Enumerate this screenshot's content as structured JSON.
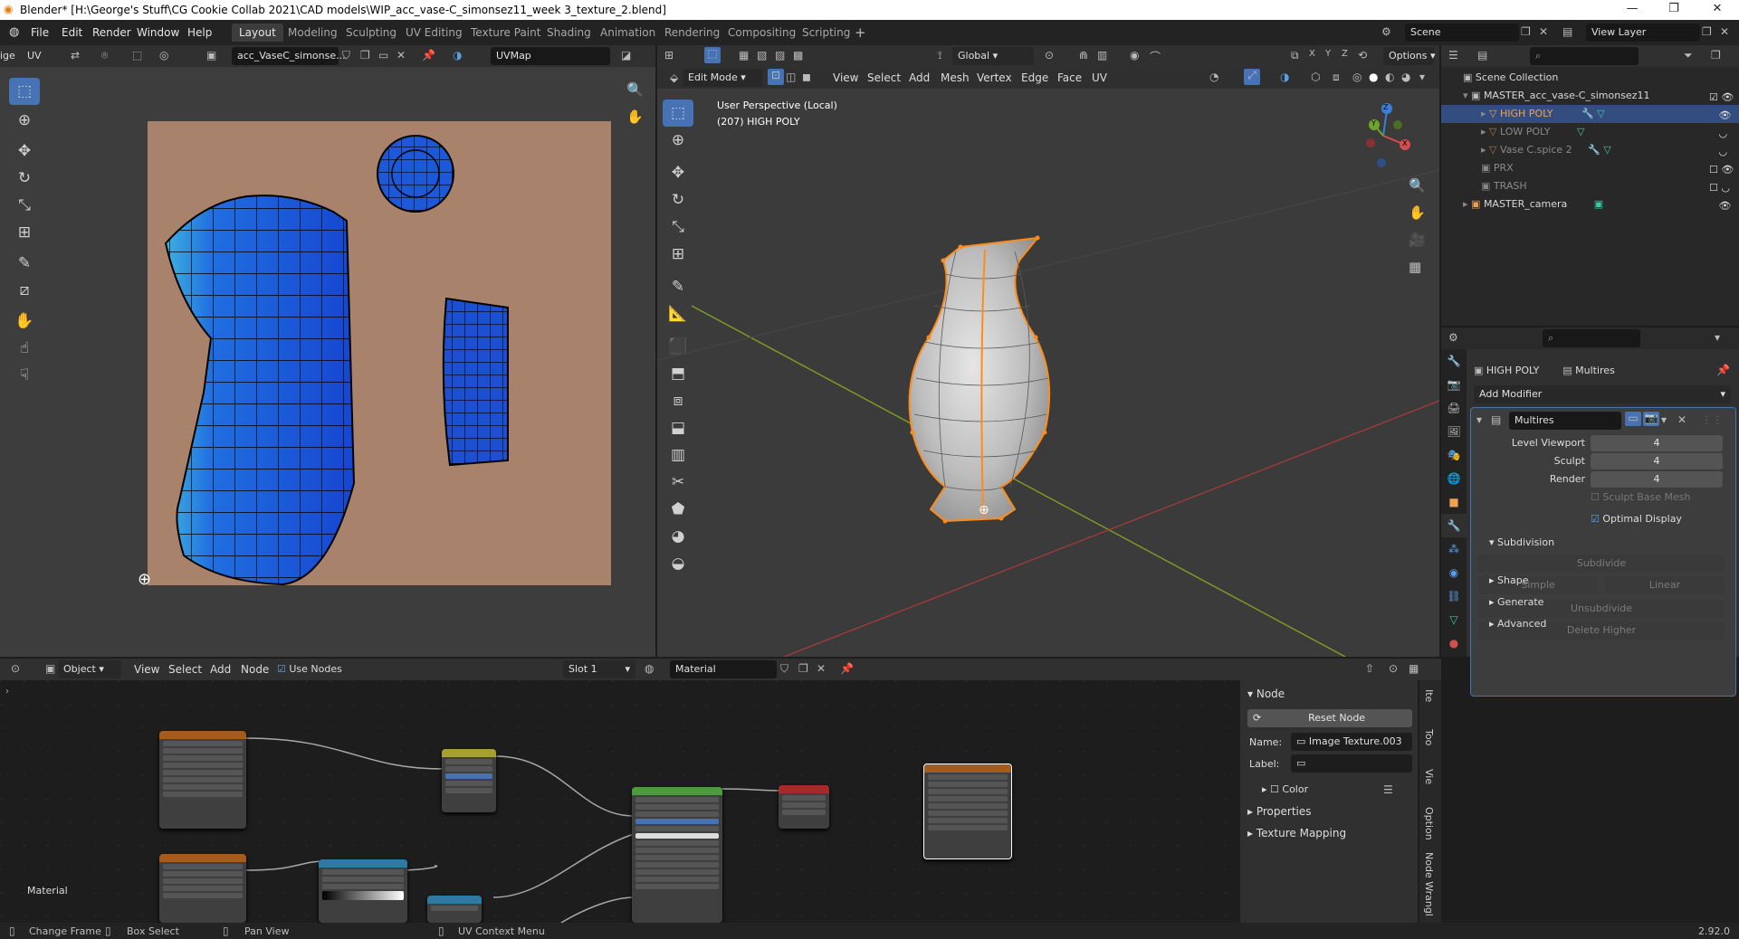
{
  "window": {
    "title": "Blender* [H:\\George's Stuff\\CG Cookie Collab 2021\\CAD models\\WIP_acc_vase-C_simonsez11_week 3_texture_2.blend]",
    "controls": [
      "—",
      "❐",
      "✕"
    ]
  },
  "menu": [
    "File",
    "Edit",
    "Render",
    "Window",
    "Help"
  ],
  "workspaces": [
    "Layout",
    "Modeling",
    "Sculpting",
    "UV Editing",
    "Texture Paint",
    "Shading",
    "Animation",
    "Rendering",
    "Compositing",
    "Scripting"
  ],
  "active_workspace": "Layout",
  "scene": {
    "label": "Scene",
    "view_layer": "View Layer"
  },
  "uv_editor": {
    "header_type": "ige",
    "menu": "UV",
    "image_name": "acc_VaseC_simonse...",
    "uvmap": "UVMap"
  },
  "viewport": {
    "mode": "Edit Mode",
    "menus": [
      "View",
      "Select",
      "Add",
      "Mesh",
      "Vertex",
      "Edge",
      "Face",
      "UV"
    ],
    "orientation": "Global",
    "options": "Options",
    "overlay_line1": "User Perspective (Local)",
    "overlay_line2": "(207) HIGH POLY",
    "gizmo_axes": [
      "Z",
      "Y",
      "X"
    ]
  },
  "outliner": {
    "root": "Scene Collection",
    "items": [
      {
        "label": "MASTER_acc_vase-C_simonsez11",
        "indent": 0,
        "color": "#d9d9d9"
      },
      {
        "label": "HIGH POLY",
        "indent": 1,
        "color": "#f0a050"
      },
      {
        "label": "LOW POLY",
        "indent": 1,
        "color": "#8a8a8a"
      },
      {
        "label": "Vase C.spice 2",
        "indent": 1,
        "color": "#8a8a8a"
      },
      {
        "label": "PRX",
        "indent": 0,
        "color": "#8a8a8a"
      },
      {
        "label": "TRASH",
        "indent": 0,
        "color": "#8a8a8a"
      },
      {
        "label": "MASTER_camera",
        "indent": 0,
        "color": "#d9d9d9"
      }
    ]
  },
  "properties": {
    "object_name": "HIGH POLY",
    "modifier_context": "Multires",
    "add_modifier": "Add Modifier",
    "modifier_name": "Multires",
    "fields": [
      {
        "label": "Level Viewport",
        "value": "4"
      },
      {
        "label": "Sculpt",
        "value": "4"
      },
      {
        "label": "Render",
        "value": "4"
      }
    ],
    "sculpt_base_mesh": "Sculpt Base Mesh",
    "optimal_display": "Optimal Display",
    "subdivision": "Subdivision",
    "subdivide": "Subdivide",
    "simple": "Simple",
    "linear": "Linear",
    "unsubdivide": "Unsubdivide",
    "delete_higher": "Delete Higher",
    "shape": "Shape",
    "generate": "Generate",
    "advanced": "Advanced"
  },
  "node_editor": {
    "mode": "Object",
    "menus": [
      "View",
      "Select",
      "Add",
      "Node"
    ],
    "use_nodes": "Use Nodes",
    "slot": "Slot 1",
    "material": "Material",
    "frame_label": "Material"
  },
  "node_panel": {
    "title": "Node",
    "reset": "Reset Node",
    "name_label": "Name:",
    "name_value": "Image Texture.003",
    "label_label": "Label:",
    "color": "Color",
    "properties": "Properties",
    "texture_mapping": "Texture Mapping",
    "vtabs": [
      "Ite",
      "Too",
      "Vie",
      "Option",
      "Node Wrangl"
    ]
  },
  "statusbar": {
    "items": [
      "Change Frame",
      "Box Select",
      "Pan View",
      "UV Context Menu"
    ],
    "version": "2.92.0"
  }
}
